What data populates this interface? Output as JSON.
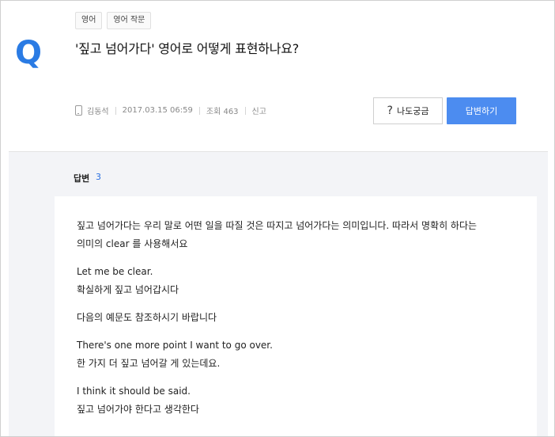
{
  "question": {
    "mark": "Q",
    "tags": [
      "영어",
      "영어 작문"
    ],
    "title": "'짚고 넘어가다' 영어로 어떻게 표현하나요?",
    "meta": {
      "author": "김동석",
      "datetime": "2017.03.15 06:59",
      "views": "조회 463",
      "report": "신고"
    },
    "curious_button": "나도궁금",
    "answer_button": "답변하기"
  },
  "answers": {
    "label": "답변",
    "count": "3",
    "first": {
      "paragraphs": [
        [
          "짚고 넘어가다는 우리 말로 어떤 일을 따질 것은 따지고 넘어가다는 의미입니다. 따라서 명확히 하다는",
          "의미의 clear 를 사용해서요"
        ],
        [
          "Let me be clear.",
          "확실하게 짚고 넘어갑시다"
        ],
        [
          "다음의 예문도 참조하시기 바랍니다"
        ],
        [
          "There's one more point I want to go over.",
          "한 가지 더 짚고 넘어갈 게 있는데요."
        ],
        [
          "I think it should be said.",
          "짚고 넘어가야 한다고 생각한다"
        ]
      ]
    }
  }
}
